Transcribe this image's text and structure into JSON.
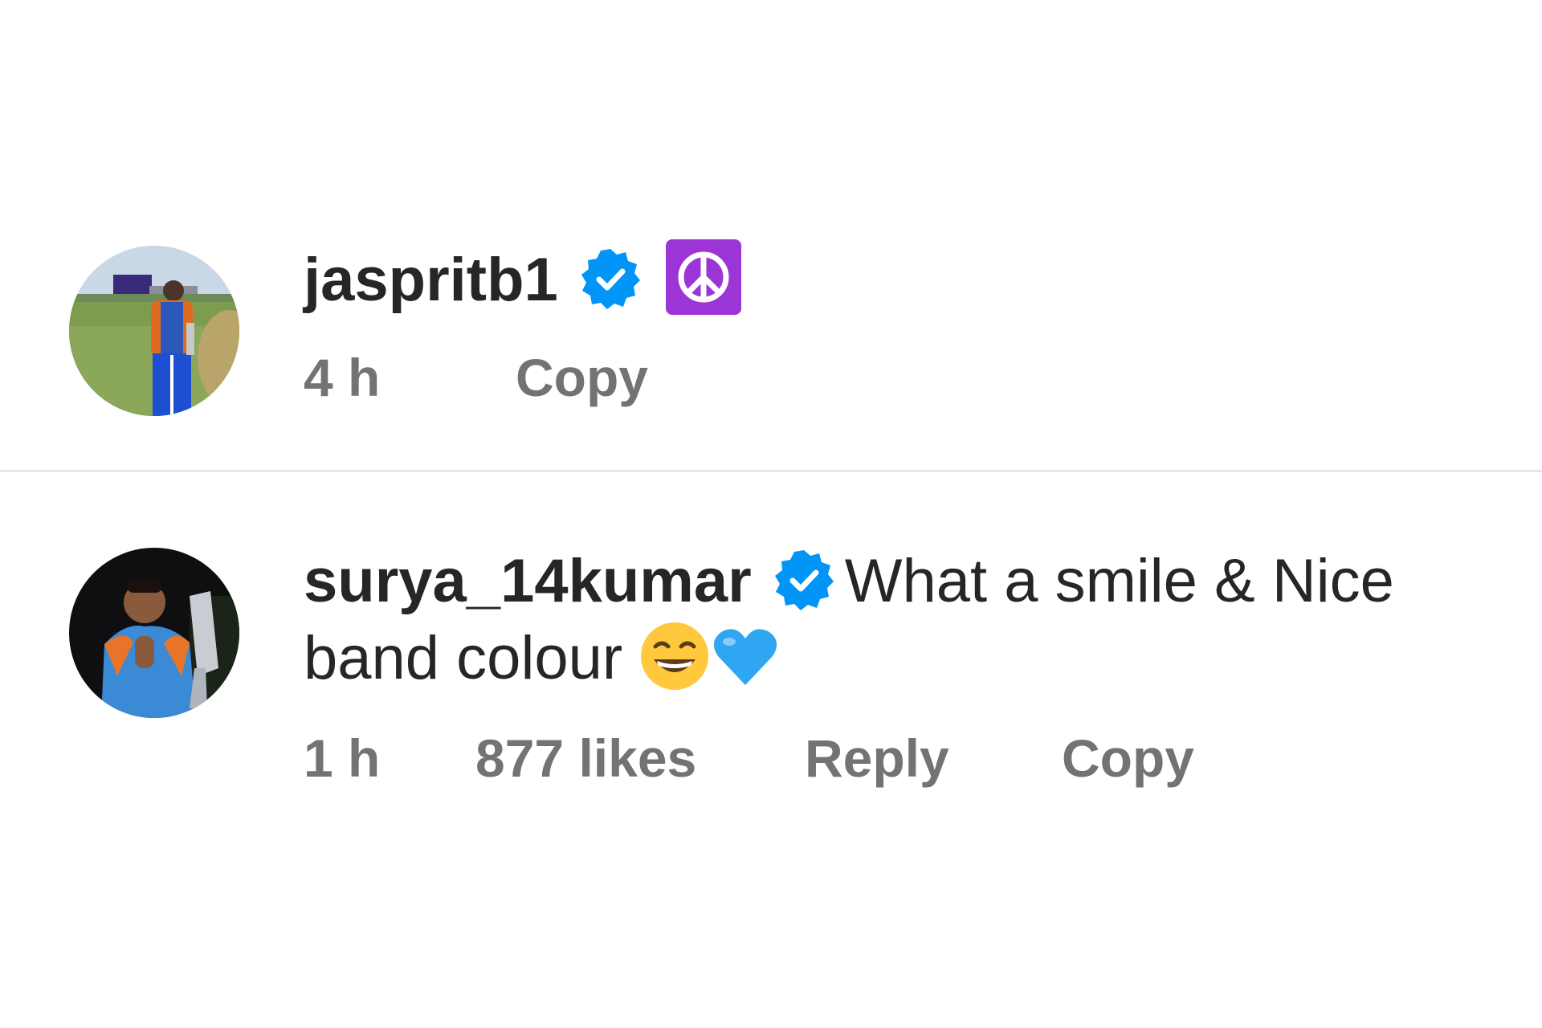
{
  "comments": [
    {
      "username": "jaspritb1",
      "verified": true,
      "text": "",
      "emoji": [
        "peace-symbol"
      ],
      "time": "4 h",
      "likes": "",
      "reply_label": "",
      "copy_label": "Copy"
    },
    {
      "username": "surya_14kumar",
      "verified": true,
      "text_line1": "What a smile & Nice",
      "text_line2": "band colour",
      "emoji": [
        "grinning-face-with-smiling-eyes",
        "blue-heart"
      ],
      "time": "1 h",
      "likes": "877 likes",
      "reply_label": "Reply",
      "copy_label": "Copy"
    }
  ],
  "colors": {
    "text_primary": "#262626",
    "text_secondary": "#737373",
    "verified_badge": "#0095f6",
    "divider": "#e6e6e6",
    "peace_tile": "#9b35d6"
  }
}
